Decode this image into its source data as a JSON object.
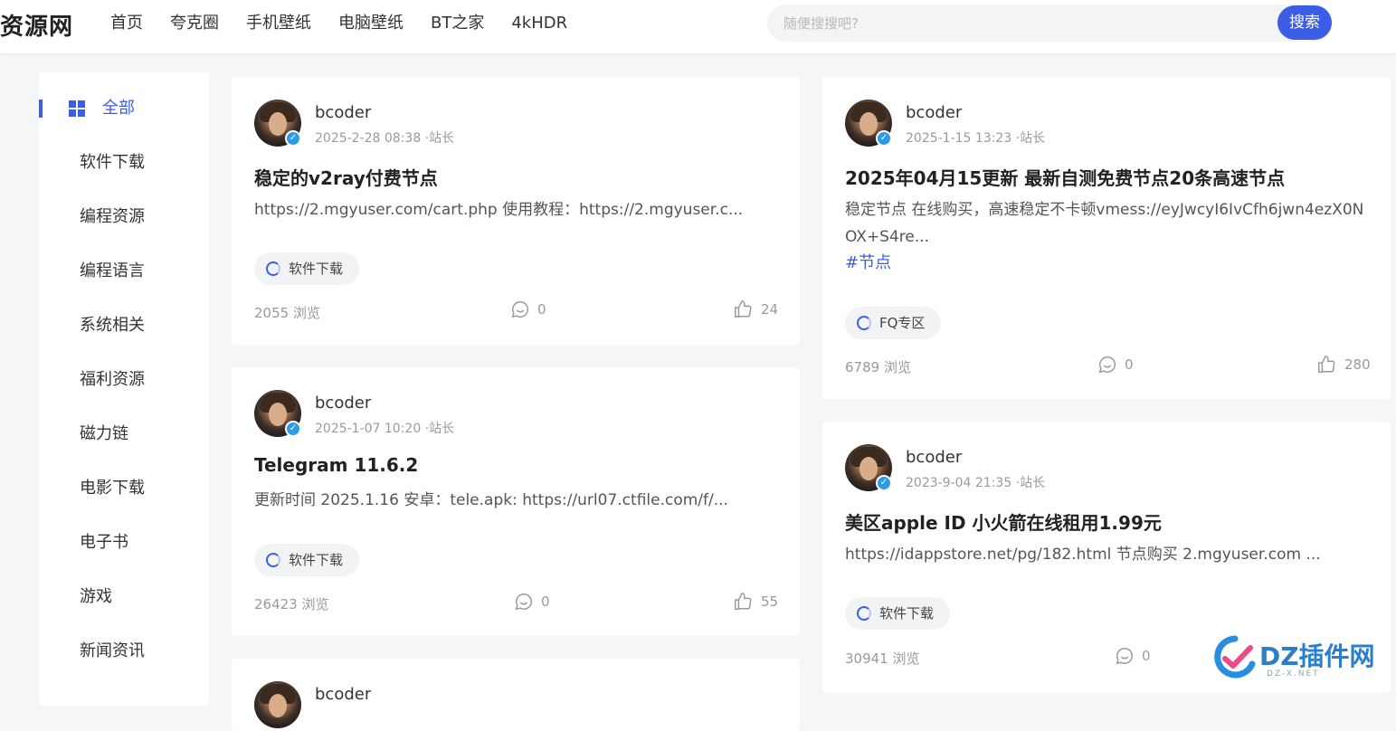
{
  "header": {
    "logo": "资源网",
    "nav": [
      "首页",
      "夸克圈",
      "手机壁纸",
      "电脑壁纸",
      "BT之家",
      "4kHDR"
    ],
    "search_placeholder": "随便搜搜吧?",
    "search_button": "搜索",
    "accent_color": "#3c5ee6"
  },
  "sidebar": {
    "items": [
      "全部",
      "软件下载",
      "编程资源",
      "编程语言",
      "系统相关",
      "福利资源",
      "磁力链",
      "电影下载",
      "电子书",
      "游戏",
      "新闻资讯"
    ],
    "active_index": 0
  },
  "posts": [
    {
      "author": "bcoder",
      "meta": "2025-2-28 08:38 ·站长",
      "title": "稳定的v2ray付费节点",
      "excerpt": "https://2.mgyuser.com/cart.php 使用教程：https://2.mgyuser.c...",
      "category": "软件下载",
      "views": "2055 浏览",
      "comments": "0",
      "likes": "24"
    },
    {
      "author": "bcoder",
      "meta": "2025-1-07 10:20 ·站长",
      "title": "Telegram 11.6.2",
      "excerpt": "更新时间 2025.1.16 安卓：tele.apk: https://url07.ctfile.com/f/...",
      "category": "软件下载",
      "views": "26423 浏览",
      "comments": "0",
      "likes": "55"
    },
    {
      "author": "bcoder",
      "meta": "2025-1-15 13:23 ·站长",
      "title": "2025年04月15更新 最新自测免费节点20条高速节点",
      "excerpt_line1": "稳定节点 在线购买，高速稳定不卡顿vmess://eyJwcyI6IvCfh6jwn4ezX0N",
      "excerpt_line2": "OX+S4re...",
      "hashtag": "#节点",
      "category": "FQ专区",
      "views": "6789 浏览",
      "comments": "0",
      "likes": "280"
    },
    {
      "author": "bcoder",
      "meta": "2023-9-04 21:35 ·站长",
      "title": "美区apple ID 小火箭在线租用1.99元",
      "excerpt": "https://idappstore.net/pg/182.html 节点购买  2.mgyuser.com ...",
      "category": "软件下载",
      "views": "30941 浏览",
      "comments": "0"
    },
    {
      "author": "bcoder"
    }
  ],
  "watermark": {
    "text": "DZ插件网",
    "sub": "DZ-X.NET"
  }
}
